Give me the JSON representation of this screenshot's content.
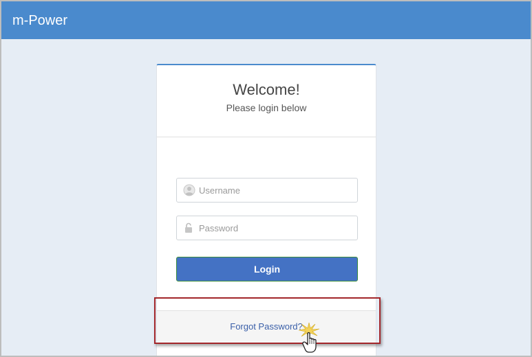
{
  "header": {
    "title": "m-Power"
  },
  "login": {
    "heading": "Welcome!",
    "subheading": "Please login below",
    "username_placeholder": "Username",
    "password_placeholder": "Password",
    "login_label": "Login",
    "forgot_label": "Forgot Password?"
  },
  "icons": {
    "username": "user-circle-icon",
    "password": "unlock-icon",
    "cursor": "hand-pointer-icon"
  },
  "colors": {
    "header": "#4a8acd",
    "background": "#e6edf5",
    "login_button": "#4472c4",
    "link": "#3a5fa8",
    "highlight": "#a3262a"
  }
}
